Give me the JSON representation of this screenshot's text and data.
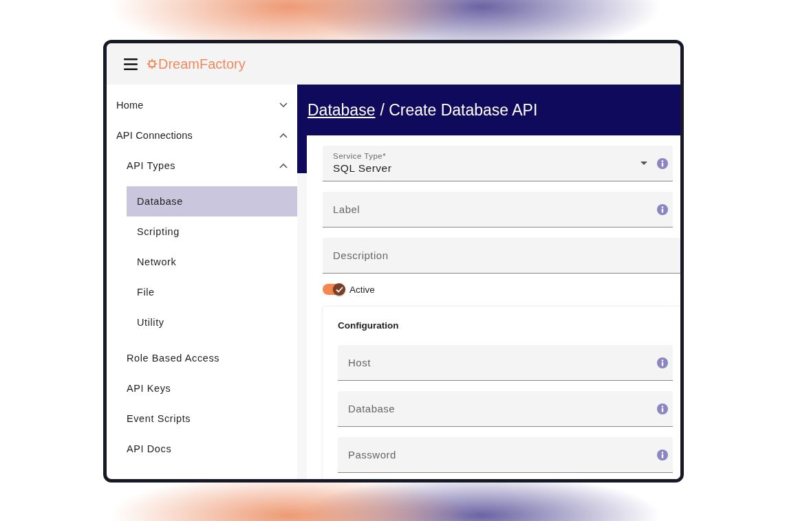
{
  "header": {
    "brand": "DreamFactory"
  },
  "sidebar": {
    "items": [
      {
        "label": "Home",
        "expanded": false,
        "selected": false
      },
      {
        "label": "API Connections",
        "expanded": true,
        "selected": false,
        "children": [
          {
            "label": "API Types",
            "expanded": true,
            "selected": false,
            "children": [
              {
                "label": "Database",
                "selected": true
              },
              {
                "label": "Scripting",
                "selected": false
              },
              {
                "label": "Network",
                "selected": false
              },
              {
                "label": "File",
                "selected": false
              },
              {
                "label": "Utility",
                "selected": false
              }
            ]
          },
          {
            "label": "Role Based Access",
            "selected": false
          },
          {
            "label": "API Keys",
            "selected": false
          },
          {
            "label": "Event Scripts",
            "selected": false
          },
          {
            "label": "API Docs",
            "selected": false
          }
        ]
      }
    ]
  },
  "page": {
    "breadcrumb_link": "Database",
    "title": "/ Create Database API"
  },
  "form": {
    "service_type": {
      "label": "Service Type*",
      "value": "SQL Server"
    },
    "fields": [
      {
        "placeholder": "Label",
        "info": true
      },
      {
        "placeholder": "Description",
        "info": false
      }
    ],
    "active": {
      "label": "Active",
      "on": true
    },
    "configuration": {
      "title": "Configuration",
      "fields": [
        {
          "placeholder": "Host",
          "info": true
        },
        {
          "placeholder": "Database",
          "info": true
        },
        {
          "placeholder": "Password",
          "info": true
        }
      ]
    }
  }
}
